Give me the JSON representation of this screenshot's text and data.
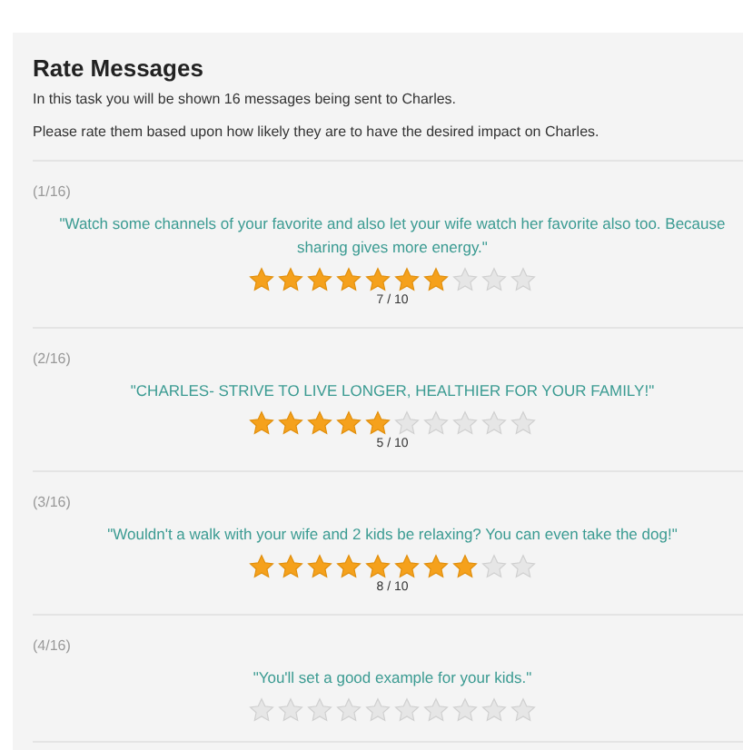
{
  "title": "Rate Messages",
  "intro": [
    "In this task you will be shown 16 messages being sent to Charles.",
    "Please rate them based upon how likely they are to have the desired impact on Charles."
  ],
  "messages": [
    {
      "index": "(1/16)",
      "text": "\"Watch some channels of your favorite and also let your wife watch her favorite also too. Because sharing gives more energy.\"",
      "stars": 7,
      "reading": "7 / 10"
    },
    {
      "index": "(2/16)",
      "text": "\"CHARLES- STRIVE TO LIVE LONGER, HEALTHIER FOR YOUR FAMILY!\"",
      "stars": 5,
      "reading": "5 / 10"
    },
    {
      "index": "(3/16)",
      "text": "\"Wouldn't a walk with your wife and 2 kids be relaxing? You can even take the dog!\"",
      "stars": 8,
      "reading": "8 / 10"
    },
    {
      "index": "(4/16)",
      "text": "\"You'll set a good example for your kids.\"",
      "stars": 0
    }
  ]
}
